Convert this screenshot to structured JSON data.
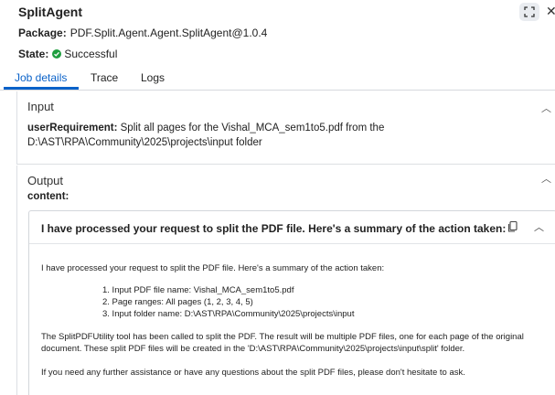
{
  "header": {
    "title": "SplitAgent",
    "package_label": "Package:",
    "package_value": "PDF.Split.Agent.Agent.SplitAgent@1.0.4",
    "state_label": "State:",
    "state_value": "Successful",
    "state_icon": "check-circle-icon",
    "success_color": "#1e9e3f"
  },
  "tabs": [
    {
      "label": "Job details",
      "active": true
    },
    {
      "label": "Trace",
      "active": false
    },
    {
      "label": "Logs",
      "active": false
    }
  ],
  "accent_color": "#0a62c9",
  "input_section": {
    "heading": "Input",
    "key": "userRequirement:",
    "value": "Split all pages for the Vishal_MCA_sem1to5.pdf from the D:\\AST\\RPA\\Community\\2025\\projects\\input folder"
  },
  "output_section": {
    "heading": "Output",
    "content_label": "content:",
    "card_title": "I have processed your request to split the PDF file. Here's a summary of the action taken:",
    "intro": "I have processed your request to split the PDF file. Here's a summary of the action taken:",
    "steps": [
      "1. Input PDF file name: Vishal_MCA_sem1to5.pdf",
      "2. Page ranges: All pages (1, 2, 3, 4, 5)",
      "3. Input folder name: D:\\AST\\RPA\\Community\\2025\\projects\\input"
    ],
    "paragraph": "The SplitPDFUtility tool has been called to split the PDF. The result will be multiple PDF files, one for each page of the original document. These split PDF files will be created in the 'D:\\AST\\RPA\\Community\\2025\\projects\\input\\split' folder.",
    "closing": "If you need any further assistance or have any questions about the split PDF files, please don't hesitate to ask."
  }
}
